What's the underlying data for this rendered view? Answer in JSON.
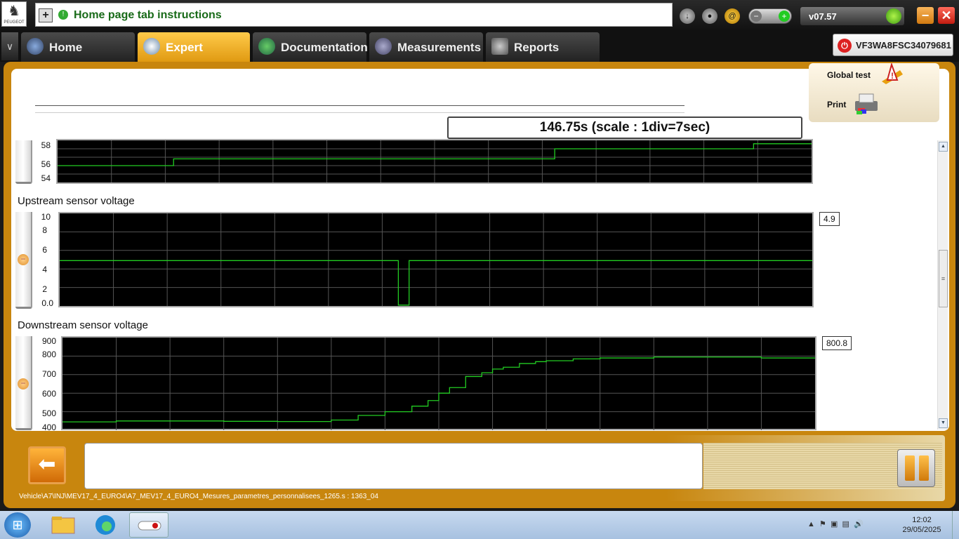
{
  "title_bar": {
    "title": "Home page tab instructions",
    "version": "v07.57",
    "brand_logo_text": "PEUGEOT",
    "icons": [
      "download-icon",
      "user-icon",
      "at-icon",
      "zoom-toggle",
      "connection-icon"
    ]
  },
  "nav": {
    "tabs": [
      {
        "label": "Home",
        "icon": "globe-icon",
        "active": false
      },
      {
        "label": "Expert",
        "icon": "magnifier-icon",
        "active": true
      },
      {
        "label": "Documentation",
        "icon": "book-icon",
        "active": false
      },
      {
        "label": "Measurements",
        "icon": "waveform-icon",
        "active": false
      },
      {
        "label": "Reports",
        "icon": "document-icon",
        "active": false
      }
    ],
    "vin": "VF3WA8FSC34079681"
  },
  "side_panel": {
    "global_test_label": "Global test",
    "print_label": "Print"
  },
  "time_display": "146.75s (scale : 1div=7sec)",
  "graphs": [
    {
      "label": "",
      "ticks": [
        "58",
        "56",
        "54"
      ],
      "value": ""
    },
    {
      "label": "Upstream sensor voltage",
      "ticks": [
        "10",
        "8",
        "6",
        "4",
        "2",
        "0.0"
      ],
      "value": "4.9"
    },
    {
      "label": "Downstream sensor voltage",
      "ticks": [
        "900",
        "800",
        "700",
        "600",
        "500",
        "400"
      ],
      "value": "800.8"
    }
  ],
  "chart_data": [
    {
      "type": "line",
      "title": "",
      "ylim": [
        54,
        59
      ],
      "x": [
        0,
        5,
        14,
        20,
        42,
        54,
        60,
        64,
        70,
        77,
        84,
        91
      ],
      "series": [
        {
          "values": [
            56,
            56,
            56.8,
            56.8,
            56.8,
            56.8,
            58,
            58,
            58,
            58,
            58.6,
            58.6
          ]
        }
      ],
      "color": "#22cc22"
    },
    {
      "type": "line",
      "title": "Upstream sensor voltage",
      "ylim": [
        0,
        10
      ],
      "x": [
        0,
        20,
        40,
        60,
        62,
        63,
        64,
        65,
        80,
        100,
        120,
        140
      ],
      "series": [
        {
          "values": [
            4.9,
            4.9,
            4.9,
            4.9,
            4.9,
            0.1,
            0.1,
            4.9,
            4.9,
            4.9,
            4.9,
            4.9
          ]
        }
      ],
      "color": "#22cc22"
    },
    {
      "type": "line",
      "title": "Downstream sensor voltage",
      "ylim": [
        400,
        900
      ],
      "x": [
        0,
        10,
        20,
        30,
        40,
        50,
        55,
        60,
        65,
        68,
        70,
        72,
        75,
        78,
        80,
        82,
        85,
        88,
        90,
        95,
        100,
        110,
        120,
        130,
        140
      ],
      "series": [
        {
          "values": [
            445,
            450,
            450,
            448,
            447,
            455,
            480,
            500,
            530,
            560,
            600,
            630,
            690,
            710,
            730,
            740,
            760,
            770,
            775,
            785,
            790,
            795,
            795,
            790,
            790
          ]
        }
      ],
      "color": "#22cc22"
    }
  ],
  "bottom": {
    "back_label": "back",
    "path": "Vehicle\\A7\\INJ\\MEV17_4_EURO4\\A7_MEV17_4_EURO4_Mesures_parametres_personnalisees_1265.s : 1363_04"
  },
  "taskbar": {
    "time": "12:02",
    "date": "29/05/2025"
  }
}
